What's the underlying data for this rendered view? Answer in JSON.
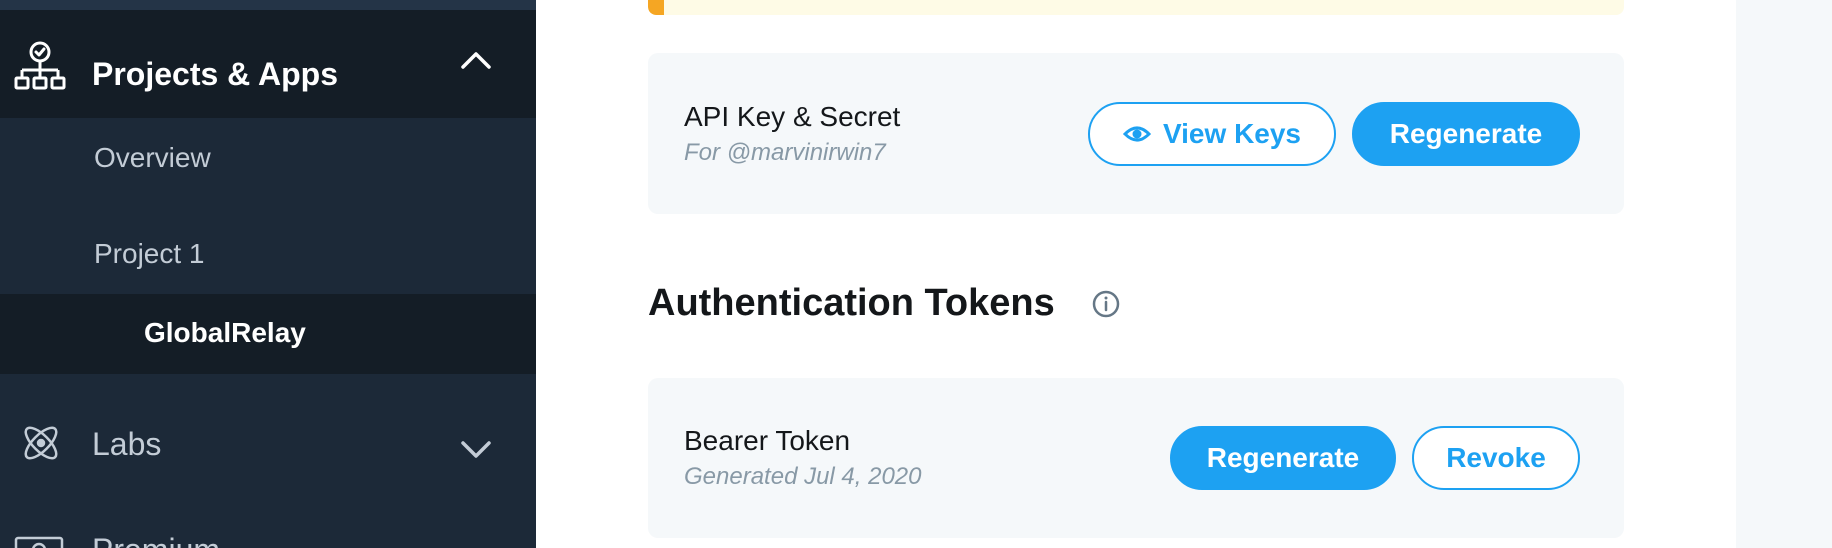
{
  "sidebar": {
    "projects": {
      "label": "Projects & Apps",
      "icon": "org-chart-icon",
      "expanded": true
    },
    "items": [
      {
        "label": "Overview"
      },
      {
        "label": "Project 1"
      },
      {
        "label": "GlobalRelay",
        "selected": true
      }
    ],
    "labs": {
      "label": "Labs",
      "icon": "atom-icon"
    },
    "premium": {
      "label": "Premium",
      "icon": "premium-icon"
    }
  },
  "api_card": {
    "title": "API Key & Secret",
    "subtitle": "For @marvinirwin7",
    "view_keys_label": "View Keys",
    "regenerate_label": "Regenerate"
  },
  "auth_section": {
    "title": "Authentication Tokens"
  },
  "bearer_card": {
    "title": "Bearer Token",
    "subtitle": "Generated Jul 4, 2020",
    "regenerate_label": "Regenerate",
    "revoke_label": "Revoke"
  },
  "colors": {
    "sidebar_bg": "#1c2938",
    "sidebar_active_bg": "#141d26",
    "accent": "#1da1f2",
    "alert_accent": "#f5a623",
    "alert_bg": "#fefbe6",
    "card_bg": "#f5f8fa"
  }
}
